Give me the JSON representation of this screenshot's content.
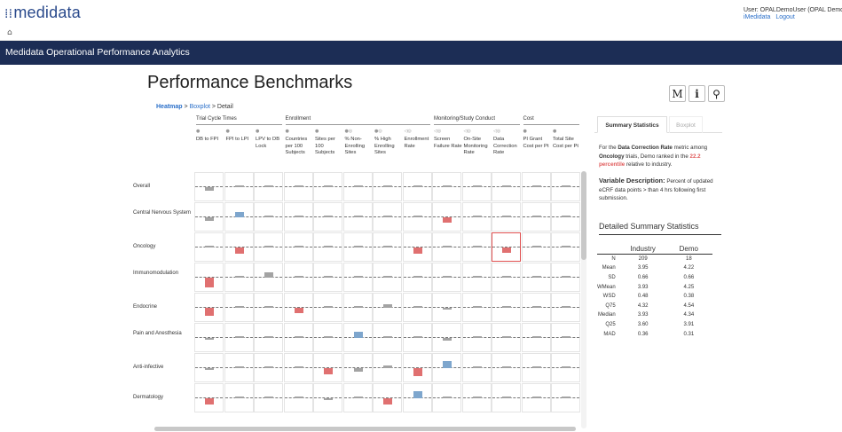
{
  "app": {
    "logo": "medidata",
    "logo_glyph": "⁞⁞",
    "user": "User: OPALDemoUser (OPAL Demo",
    "links": [
      "iMedidata",
      "Logout"
    ],
    "home_icon": "home-icon",
    "nav_title": "Medidata Operational Performance Analytics"
  },
  "page": {
    "title": "Performance Benchmarks",
    "tools": [
      "M",
      "i",
      "🔍"
    ],
    "breadcrumb": {
      "heatmap": "Heatmap",
      "sep1": " > ",
      "boxplot": "Boxplot",
      "sep2": " > ",
      "detail": "Detail"
    }
  },
  "heatmap": {
    "groups": [
      {
        "label": "Trial Cycle Times",
        "start": 0,
        "end": 2
      },
      {
        "label": "Enrollment",
        "start": 3,
        "end": 7
      },
      {
        "label": "Monitoring/Study Conduct",
        "start": 8,
        "end": 10
      },
      {
        "label": "Cost",
        "start": 11,
        "end": 12
      }
    ],
    "columns": [
      {
        "label": "DB to FPI",
        "icon": "●"
      },
      {
        "label": "FPI to LPI",
        "icon": "●"
      },
      {
        "label": "LPV to DB Lock",
        "icon": "●"
      },
      {
        "label": "Countries per 100 Subjects",
        "icon": "●"
      },
      {
        "label": "Sites per 100 Subjects",
        "icon": "●"
      },
      {
        "label": "% Non-Enrolling Sites",
        "icon": "●◎"
      },
      {
        "label": "% High Enrolling Sites",
        "icon": "●◎"
      },
      {
        "label": "Enrollment Rate",
        "icon": "◁◎"
      },
      {
        "label": "Screen Failure Rate",
        "icon": "◁◎"
      },
      {
        "label": "On-Site Monitoring Rate",
        "icon": "◁◎"
      },
      {
        "label": "Data Correction Rate",
        "icon": "◁◎"
      },
      {
        "label": "PI Grant Cost per Pt",
        "icon": "●"
      },
      {
        "label": "Total Site Cost per Pt",
        "icon": "●"
      }
    ],
    "rows": [
      {
        "label": "Overall",
        "values": [
          -0.6,
          0,
          0.3,
          0,
          0,
          0,
          0,
          0,
          0,
          0,
          0,
          0,
          0
        ],
        "colors": [
          "#a3a3a3",
          "#a3a3a3",
          "#a3a3a3",
          "#a3a3a3",
          "#a3a3a3",
          "#a3a3a3",
          "#a3a3a3",
          "#a3a3a3",
          "#a3a3a3",
          "#a3a3a3",
          "#a3a3a3",
          "#a3a3a3",
          "#a3a3a3"
        ]
      },
      {
        "label": "Central Nervous System",
        "values": [
          -0.5,
          0.8,
          0,
          0,
          0,
          0,
          0,
          0,
          -0.9,
          0,
          0,
          0,
          0
        ],
        "colors": [
          "#a3a3a3",
          "#7ea6cd",
          "#a3a3a3",
          "#a3a3a3",
          "#a3a3a3",
          "#a3a3a3",
          "#a3a3a3",
          "#a3a3a3",
          "#e07070",
          "#a3a3a3",
          "#a3a3a3",
          "#a3a3a3",
          "#a3a3a3"
        ]
      },
      {
        "label": "Oncology",
        "values": [
          0,
          -1,
          0,
          0,
          0,
          0.3,
          0,
          -1,
          0,
          0,
          -0.8,
          0,
          0
        ],
        "colors": [
          "#a3a3a3",
          "#e07070",
          "#a3a3a3",
          "#a3a3a3",
          "#a3a3a3",
          "#a3a3a3",
          "#a3a3a3",
          "#e07070",
          "#a3a3a3",
          "#a3a3a3",
          "#e07070",
          "#a3a3a3",
          "#a3a3a3"
        ]
      },
      {
        "label": "Immunomodulation",
        "values": [
          -1.6,
          0,
          0.8,
          0,
          0,
          0.3,
          0,
          0,
          0,
          0,
          0,
          0,
          0
        ],
        "colors": [
          "#e07070",
          "#a3a3a3",
          "#a3a3a3",
          "#a3a3a3",
          "#a3a3a3",
          "#a3a3a3",
          "#a3a3a3",
          "#a3a3a3",
          "#a3a3a3",
          "#a3a3a3",
          "#a3a3a3",
          "#a3a3a3",
          "#a3a3a3"
        ]
      },
      {
        "label": "Endocrine",
        "values": [
          -1.3,
          0,
          0,
          -0.9,
          0,
          0,
          0.6,
          0,
          -0.3,
          0,
          0,
          0,
          0
        ],
        "colors": [
          "#e07070",
          "#a3a3a3",
          "#a3a3a3",
          "#e07070",
          "#a3a3a3",
          "#a3a3a3",
          "#a3a3a3",
          "#a3a3a3",
          "#a3a3a3",
          "#a3a3a3",
          "#a3a3a3",
          "#a3a3a3",
          "#a3a3a3"
        ]
      },
      {
        "label": "Pain and Anesthesia",
        "values": [
          -0.3,
          0,
          0,
          0,
          0,
          1,
          0,
          0,
          -0.4,
          0,
          0,
          0,
          0
        ],
        "colors": [
          "#a3a3a3",
          "#a3a3a3",
          "#a3a3a3",
          "#a3a3a3",
          "#a3a3a3",
          "#7ea6cd",
          "#a3a3a3",
          "#a3a3a3",
          "#a3a3a3",
          "#a3a3a3",
          "#a3a3a3",
          "#a3a3a3",
          "#a3a3a3"
        ]
      },
      {
        "label": "Anti-infective",
        "values": [
          -0.3,
          0,
          0.3,
          0,
          -1,
          -0.5,
          0.4,
          -1.3,
          1.2,
          0,
          0,
          0,
          0
        ],
        "colors": [
          "#a3a3a3",
          "#a3a3a3",
          "#a3a3a3",
          "#a3a3a3",
          "#e07070",
          "#a3a3a3",
          "#a3a3a3",
          "#e07070",
          "#7ea6cd",
          "#a3a3a3",
          "#a3a3a3",
          "#a3a3a3",
          "#a3a3a3"
        ]
      },
      {
        "label": "Dermatology",
        "values": [
          -1,
          0,
          0,
          0,
          -0.3,
          0,
          -1,
          1.2,
          0,
          0,
          0,
          0,
          0.3
        ],
        "colors": [
          "#e07070",
          "#a3a3a3",
          "#a3a3a3",
          "#a3a3a3",
          "#a3a3a3",
          "#a3a3a3",
          "#e07070",
          "#7ea6cd",
          "#a3a3a3",
          "#a3a3a3",
          "#a3a3a3",
          "#a3a3a3",
          "#a3a3a3"
        ]
      }
    ],
    "selected": {
      "row": 2,
      "col": 10
    }
  },
  "panel": {
    "tab_active": "Summary Statistics",
    "tab_inactive": "Boxplot",
    "summary": {
      "p1": "For the ",
      "metric": "Data Correction Rate",
      "p2": " metric among ",
      "area": "Oncology",
      "p3": " trials, Demo ranked in the ",
      "rank": "22.2",
      "rank_word": "percentile",
      "p4": " relative to industry."
    },
    "variable": {
      "title": "Variable Description:",
      "text": " Percent of updated eCRF data points > than 4 hrs following first submission."
    },
    "detail_title": "Detailed Summary Statistics",
    "stats": {
      "headers": [
        "",
        "Industry",
        "Demo"
      ],
      "rows": [
        [
          "N",
          "209",
          "18"
        ],
        [
          "Mean",
          "3.95",
          "4.22"
        ],
        [
          "SD",
          "0.66",
          "0.66"
        ],
        [
          "WMean",
          "3.93",
          "4.25"
        ],
        [
          "WSD",
          "0.48",
          "0.38"
        ],
        [
          "Q75",
          "4.32",
          "4.54"
        ],
        [
          "Median",
          "3.93",
          "4.34"
        ],
        [
          "Q25",
          "3.60",
          "3.91"
        ],
        [
          "MAD",
          "0.36",
          "0.31"
        ]
      ]
    }
  }
}
